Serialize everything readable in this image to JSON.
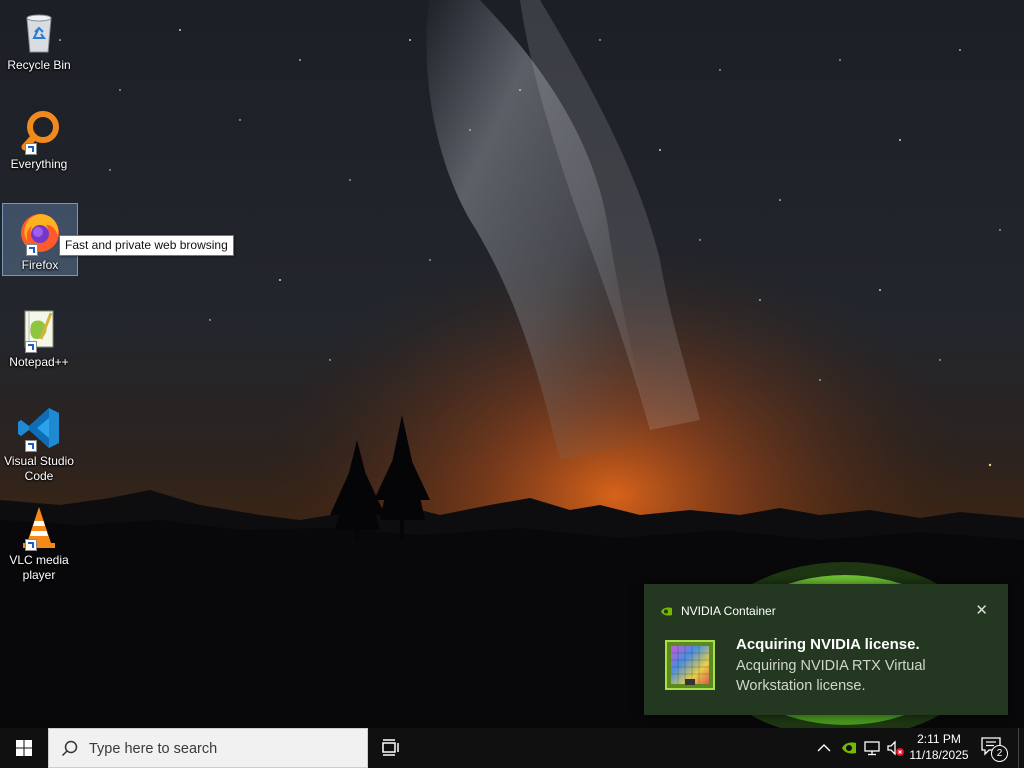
{
  "desktop": {
    "icons": [
      {
        "label": "Recycle Bin",
        "icon": "recycle-bin-icon"
      },
      {
        "label": "Everything",
        "icon": "everything-icon"
      },
      {
        "label": "Firefox",
        "icon": "firefox-icon"
      },
      {
        "label": "Notepad++",
        "icon": "notepadpp-icon"
      },
      {
        "label": "Visual Studio Code",
        "label_line1": "Visual Studio",
        "label_line2": "Code",
        "icon": "vscode-icon"
      },
      {
        "label": "VLC media player",
        "label_line1": "VLC media",
        "label_line2": "player",
        "icon": "vlc-icon"
      }
    ],
    "selected_icon": "Firefox",
    "tooltip": "Fast and private web browsing"
  },
  "toast": {
    "app_name": "NVIDIA Container",
    "title": "Acquiring NVIDIA license.",
    "body": "Acquiring NVIDIA RTX Virtual Workstation license.",
    "accent": "#76b900",
    "background": "#233721"
  },
  "taskbar": {
    "search_placeholder": "Type here to search",
    "time": "2:11 PM",
    "date": "11/18/2025",
    "notification_count": "2",
    "tray_icons": [
      "chevron-up-icon",
      "nvidia-icon",
      "network-icon",
      "volume-muted-icon"
    ]
  }
}
